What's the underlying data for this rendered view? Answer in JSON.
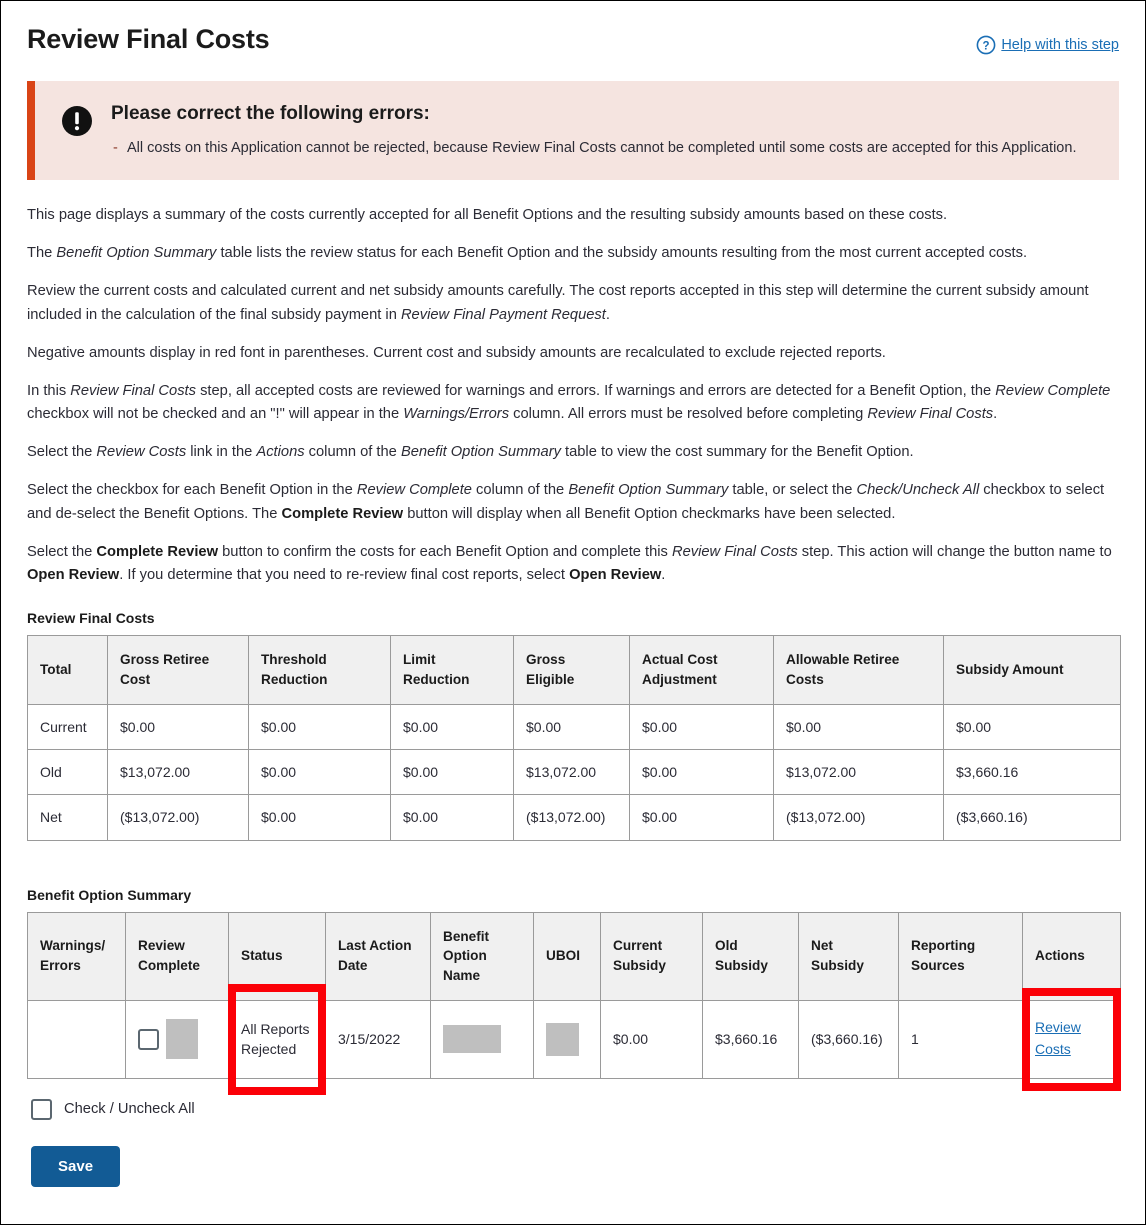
{
  "header": {
    "title": "Review Final Costs",
    "help_label": "Help with this step",
    "help_icon": "question-circle-icon"
  },
  "error_banner": {
    "icon": "exclamation-circle-icon",
    "title": "Please correct the following errors:",
    "messages": [
      "All costs on this Application cannot be rejected, because Review Final Costs cannot be completed until some costs are accepted for this Application."
    ],
    "accent_color": "#d94416",
    "background_color": "#f5e4e0"
  },
  "intro": {
    "p1": "This page displays a summary of the costs currently accepted for all Benefit Options and the resulting subsidy amounts based on these costs.",
    "p2_a": "The ",
    "p2_em1": "Benefit Option Summary",
    "p2_b": " table lists the review status for each Benefit Option and the subsidy amounts resulting from the most current accepted costs.",
    "p3_a": "Review the current costs and calculated current and net subsidy amounts carefully. The cost reports accepted in this step will determine the current subsidy amount included in the calculation of the final subsidy payment in ",
    "p3_em1": "Review Final Payment Request",
    "p3_b": ".",
    "p4": "Negative amounts display in red font in parentheses. Current cost and subsidy amounts are recalculated to exclude rejected reports.",
    "p5_a": "In this ",
    "p5_em1": "Review Final Costs",
    "p5_b": " step, all accepted costs are reviewed for warnings and errors. If warnings and errors are detected for a Benefit Option, the ",
    "p5_em2": "Review Complete",
    "p5_c": " checkbox will not be checked and an \"!\" will appear in the ",
    "p5_em3": "Warnings/Errors",
    "p5_d": " column. All errors must be resolved before completing ",
    "p5_em4": "Review Final Costs",
    "p5_e": ".",
    "p6_a": "Select the ",
    "p6_em1": "Review Costs",
    "p6_b": " link in the ",
    "p6_em2": "Actions",
    "p6_c": " column of the ",
    "p6_em3": "Benefit Option Summary",
    "p6_d": " table to view the cost summary for the Benefit Option.",
    "p7_a": "Select the checkbox for each Benefit Option in the ",
    "p7_em1": "Review Complete",
    "p7_b": " column of the ",
    "p7_em2": "Benefit Option Summary",
    "p7_c": " table, or select the ",
    "p7_em3": "Check/Uncheck All",
    "p7_d": " checkbox to select and de-select the Benefit Options. The ",
    "p7_strong1": "Complete Review",
    "p7_e": " button will display when all Benefit Option checkmarks have been selected.",
    "p8_a": "Select the ",
    "p8_strong1": "Complete Review",
    "p8_b": " button to confirm the costs for each Benefit Option and complete this ",
    "p8_em1": "Review Final Costs",
    "p8_c": " step. This action will change the button name to ",
    "p8_strong2": "Open Review",
    "p8_d": ". If you determine that you need to re-review final cost reports, select ",
    "p8_strong3": "Open Review",
    "p8_e": "."
  },
  "costs_table": {
    "caption": "Review Final Costs",
    "headers": [
      "Total",
      "Gross Retiree Cost",
      "Threshold Reduction",
      "Limit Reduction",
      "Gross Eligible",
      "Actual Cost Adjustment",
      "Allowable Retiree Costs",
      "Subsidy Amount"
    ],
    "rows": [
      {
        "label": "Current",
        "cells": [
          "$0.00",
          "$0.00",
          "$0.00",
          "$0.00",
          "$0.00",
          "$0.00",
          "$0.00"
        ],
        "negative": [
          false,
          false,
          false,
          false,
          false,
          false,
          false
        ]
      },
      {
        "label": "Old",
        "cells": [
          "$13,072.00",
          "$0.00",
          "$0.00",
          "$13,072.00",
          "$0.00",
          "$13,072.00",
          "$3,660.16"
        ],
        "negative": [
          false,
          false,
          false,
          false,
          false,
          false,
          false
        ]
      },
      {
        "label": "Net",
        "cells": [
          "($13,072.00)",
          "$0.00",
          "$0.00",
          "($13,072.00)",
          "$0.00",
          "($13,072.00)",
          "($3,660.16)"
        ],
        "negative": [
          true,
          false,
          false,
          true,
          false,
          true,
          true
        ]
      }
    ]
  },
  "summary_table": {
    "caption": "Benefit Option Summary",
    "headers": [
      "Warnings/ Errors",
      "Review Complete",
      "Status",
      "Last Action Date",
      "Benefit Option Name",
      "UBOI",
      "Current Subsidy",
      "Old Subsidy",
      "Net Subsidy",
      "Reporting Sources",
      "Actions"
    ],
    "row": {
      "warnings_errors": "",
      "review_complete_checkbox": "unchecked",
      "status": "All Reports Rejected",
      "last_action_date": "3/15/2022",
      "benefit_option_name": "",
      "uboi": "",
      "current_subsidy": "$0.00",
      "old_subsidy": "$3,660.16",
      "net_subsidy": "($3,660.16)",
      "reporting_sources": "1",
      "action_link": "Review Costs"
    },
    "highlight_color": "#fb0007"
  },
  "footer": {
    "check_all_label": "Check / Uncheck All",
    "check_all_state": "unchecked",
    "save_label": "Save",
    "save_color": "#125b95"
  }
}
